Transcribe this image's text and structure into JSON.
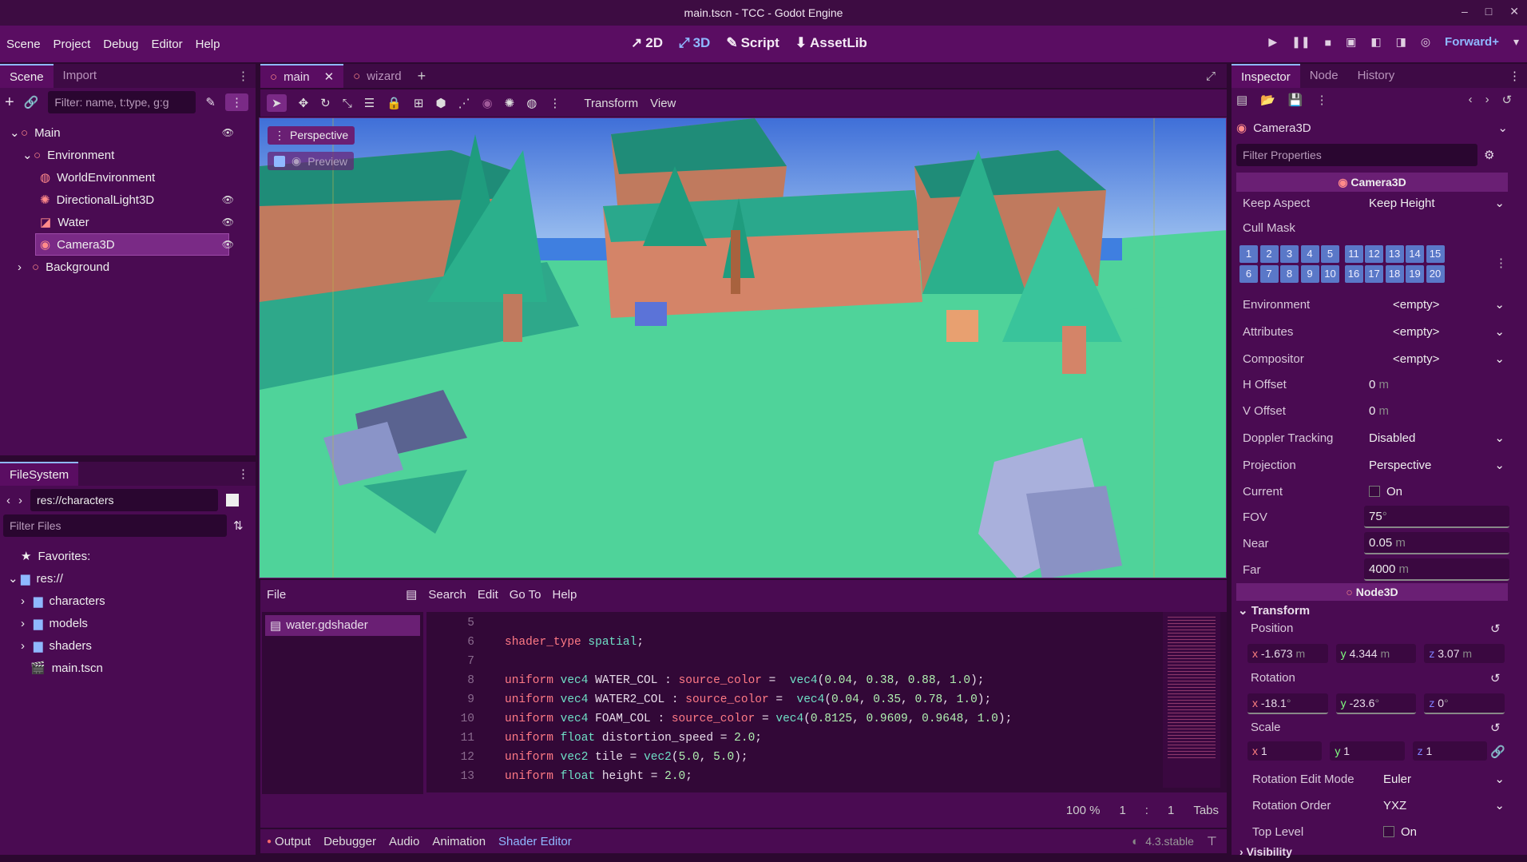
{
  "window": {
    "title": "main.tscn - TCC - Godot Engine",
    "controls": [
      "–",
      "□",
      "✕"
    ]
  },
  "menu": [
    "Scene",
    "Project",
    "Debug",
    "Editor",
    "Help"
  ],
  "main_screens": [
    {
      "label": "2D",
      "icon": "2d-icon"
    },
    {
      "label": "3D",
      "icon": "3d-icon"
    },
    {
      "label": "Script",
      "icon": "script-icon"
    },
    {
      "label": "AssetLib",
      "icon": "assetlib-icon"
    }
  ],
  "renderer": "Forward+",
  "scene_dock": {
    "tabs": [
      "Scene",
      "Import"
    ],
    "filter_placeholder": "Filter: name, t:type, g:g",
    "tree": [
      {
        "label": "Main",
        "depth": 0,
        "eye": true
      },
      {
        "label": "Environment",
        "depth": 1,
        "eye": false
      },
      {
        "label": "WorldEnvironment",
        "depth": 2,
        "eye": false
      },
      {
        "label": "DirectionalLight3D",
        "depth": 2,
        "eye": true
      },
      {
        "label": "Water",
        "depth": 2,
        "eye": true
      },
      {
        "label": "Camera3D",
        "depth": 2,
        "eye": true,
        "selected": true
      },
      {
        "label": "Background",
        "depth": 1,
        "eye": false
      }
    ]
  },
  "filesystem": {
    "tab": "FileSystem",
    "path": "res://characters",
    "filter_placeholder": "Filter Files",
    "items": [
      {
        "label": "Favorites:",
        "type": "fav"
      },
      {
        "label": "res://",
        "type": "folder"
      },
      {
        "label": "characters",
        "type": "folder"
      },
      {
        "label": "models",
        "type": "folder"
      },
      {
        "label": "shaders",
        "type": "folder"
      },
      {
        "label": "main.tscn",
        "type": "scene"
      }
    ]
  },
  "scene_tabs": [
    "main",
    "wizard"
  ],
  "viewport_toolbar": {
    "transform": "Transform",
    "view": "View",
    "perspective": "Perspective",
    "preview": "Preview"
  },
  "shader_editor": {
    "menus": [
      "File",
      "Search",
      "Edit",
      "Go To",
      "Help"
    ],
    "file": "water.gdshader",
    "lines": [
      {
        "n": "5",
        "t": ""
      },
      {
        "n": "6",
        "t": "shader_type spatial;"
      },
      {
        "n": "7",
        "t": ""
      },
      {
        "n": "8",
        "t": "uniform vec4 WATER_COL : source_color =  vec4(0.04, 0.38, 0.88, 1.0);"
      },
      {
        "n": "9",
        "t": "uniform vec4 WATER2_COL : source_color =  vec4(0.04, 0.35, 0.78, 1.0);"
      },
      {
        "n": "10",
        "t": "uniform vec4 FOAM_COL : source_color = vec4(0.8125, 0.9609, 0.9648, 1.0);"
      },
      {
        "n": "11",
        "t": "uniform float distortion_speed = 2.0;"
      },
      {
        "n": "12",
        "t": "uniform vec2 tile = vec2(5.0, 5.0);"
      },
      {
        "n": "13",
        "t": "uniform float height = 2.0;"
      }
    ],
    "zoom": "100 %",
    "line": "1",
    "col": "1",
    "indent": "Tabs"
  },
  "bottom_tabs": [
    "Output",
    "Debugger",
    "Audio",
    "Animation",
    "Shader Editor"
  ],
  "version": "4.3.stable",
  "inspector": {
    "tabs": [
      "Inspector",
      "Node",
      "History"
    ],
    "node": "Camera3D",
    "filter_placeholder": "Filter Properties",
    "section_camera": "Camera3D",
    "keep_aspect": {
      "label": "Keep Aspect",
      "value": "Keep Height"
    },
    "cull_mask": {
      "label": "Cull Mask",
      "row1": [
        "1",
        "2",
        "3",
        "4",
        "5",
        "11",
        "12",
        "13",
        "14",
        "15"
      ],
      "row2": [
        "6",
        "7",
        "8",
        "9",
        "10",
        "16",
        "17",
        "18",
        "19",
        "20"
      ]
    },
    "props": [
      {
        "label": "Environment",
        "value": "<empty>"
      },
      {
        "label": "Attributes",
        "value": "<empty>"
      },
      {
        "label": "Compositor",
        "value": "<empty>"
      }
    ],
    "h_offset": {
      "label": "H Offset",
      "value": "0",
      "unit": "m"
    },
    "v_offset": {
      "label": "V Offset",
      "value": "0",
      "unit": "m"
    },
    "doppler": {
      "label": "Doppler Tracking",
      "value": "Disabled"
    },
    "projection": {
      "label": "Projection",
      "value": "Perspective"
    },
    "current": {
      "label": "Current",
      "value": "On"
    },
    "fov": {
      "label": "FOV",
      "value": "75",
      "unit": "°"
    },
    "near": {
      "label": "Near",
      "value": "0.05",
      "unit": "m"
    },
    "far": {
      "label": "Far",
      "value": "4000",
      "unit": "m"
    },
    "section_node3d": "Node3D",
    "transform": "Transform",
    "position": {
      "label": "Position",
      "x": "-1.673",
      "y": "4.344",
      "z": "3.07",
      "unit": "m"
    },
    "rotation": {
      "label": "Rotation",
      "x": "-18.1",
      "y": "-23.6",
      "z": "0",
      "unit": "°"
    },
    "scale": {
      "label": "Scale",
      "x": "1",
      "y": "1",
      "z": "1"
    },
    "rotation_edit_mode": {
      "label": "Rotation Edit Mode",
      "value": "Euler"
    },
    "rotation_order": {
      "label": "Rotation Order",
      "value": "YXZ"
    },
    "top_level": {
      "label": "Top Level",
      "value": "On"
    },
    "visibility": "Visibility"
  },
  "colors": {
    "accent": "#8fb8ff",
    "panel": "#4a0b52",
    "menubar": "#5a0d62",
    "sky": "#5b8fe6",
    "grass": "#4fd39a"
  }
}
